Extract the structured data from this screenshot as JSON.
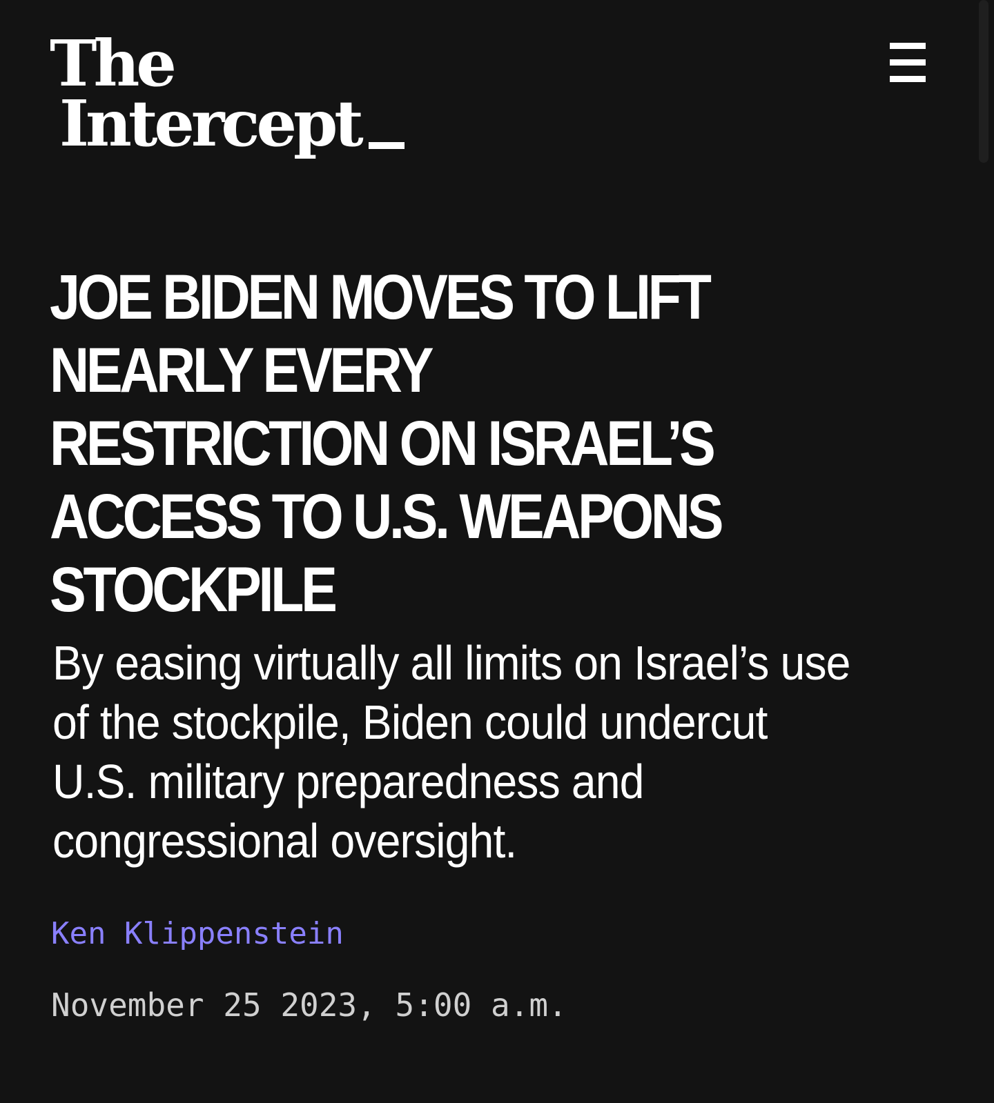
{
  "header": {
    "logo_line1": "The",
    "logo_line2": "Intercept",
    "menu_icon": "hamburger-menu-icon"
  },
  "article": {
    "headline_lines": [
      "JOE BIDEN MOVES TO LIFT",
      "NEARLY EVERY",
      "RESTRICTION ON ISRAEL’S",
      "ACCESS TO U.S. WEAPONS",
      "STOCKPILE"
    ],
    "dek_lines": [
      "By easing virtually all limits on Israel’s use",
      "of the stockpile, Biden could undercut",
      "U.S. military preparedness and",
      "congressional oversight."
    ],
    "author": "Ken Klippenstein",
    "date": "November 25 2023, 5:00 a.m."
  },
  "colors": {
    "background": "#131313",
    "text": "#ffffff",
    "author_link": "#8a80ff",
    "date_text": "#d0d0d0"
  }
}
